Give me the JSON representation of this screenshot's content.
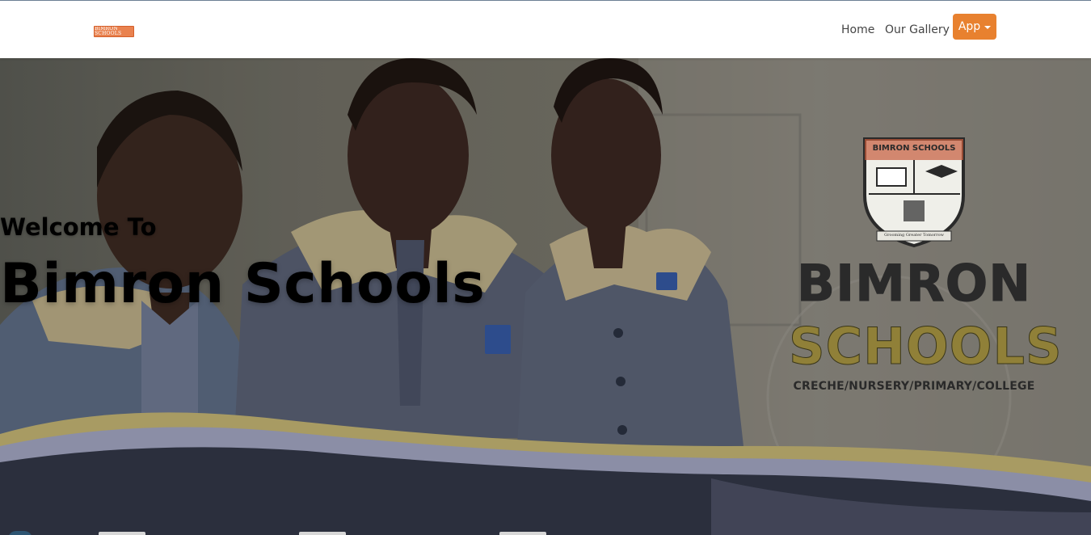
{
  "navbar": {
    "logo_text": "BIMRON SCHOOLS",
    "links": [
      {
        "label": "Home"
      },
      {
        "label": "Our Gallery"
      }
    ],
    "app_button": {
      "label": "App",
      "color": "#e8812f"
    }
  },
  "hero": {
    "welcome": "Welcome To",
    "title": "Bimron Schools"
  },
  "sign": {
    "crest_title": "BIMRON SCHOOLS",
    "crest_motto": "Grooming Greater Tomorrow",
    "name_top": "BIMRON",
    "name_bottom": "SCHOOLS",
    "subtitle": "CRECHE/NURSERY/PRIMARY/COLLEGE"
  },
  "colors": {
    "accent": "#e8812f",
    "wave_gold": "#b0a266",
    "wave_dark": "#2b2f3d"
  }
}
